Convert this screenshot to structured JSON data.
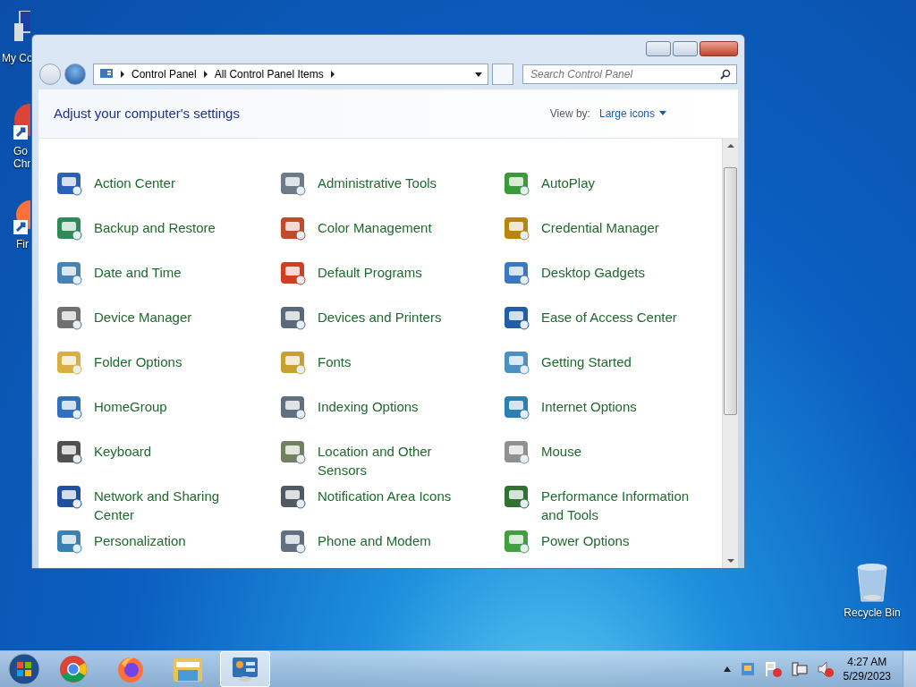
{
  "desktop_icons": [
    {
      "label": "My Co"
    },
    {
      "label": "Go Chr"
    },
    {
      "label": "Fir"
    },
    {
      "label": "Recycle Bin"
    }
  ],
  "window": {
    "breadcrumb": [
      "Control Panel",
      "All Control Panel Items"
    ],
    "search": {
      "placeholder": "Search Control Panel"
    },
    "heading": "Adjust your computer's settings",
    "view_by": {
      "label": "View by:",
      "value": "Large icons"
    },
    "items": [
      {
        "label": "Action Center"
      },
      {
        "label": "Administrative Tools"
      },
      {
        "label": "AutoPlay"
      },
      {
        "label": "Backup and Restore"
      },
      {
        "label": "Color Management"
      },
      {
        "label": "Credential Manager"
      },
      {
        "label": "Date and Time"
      },
      {
        "label": "Default Programs"
      },
      {
        "label": "Desktop Gadgets"
      },
      {
        "label": "Device Manager"
      },
      {
        "label": "Devices and Printers"
      },
      {
        "label": "Ease of Access Center"
      },
      {
        "label": "Folder Options"
      },
      {
        "label": "Fonts"
      },
      {
        "label": "Getting Started"
      },
      {
        "label": "HomeGroup"
      },
      {
        "label": "Indexing Options"
      },
      {
        "label": "Internet Options"
      },
      {
        "label": "Keyboard"
      },
      {
        "label": "Location and Other Sensors"
      },
      {
        "label": "Mouse"
      },
      {
        "label": "Network and Sharing Center"
      },
      {
        "label": "Notification Area Icons"
      },
      {
        "label": "Performance Information and Tools"
      },
      {
        "label": "Personalization"
      },
      {
        "label": "Phone and Modem"
      },
      {
        "label": "Power Options"
      }
    ]
  },
  "taskbar": {
    "apps": [
      {
        "kind": "chrome",
        "selected": false
      },
      {
        "kind": "firefox",
        "selected": false
      },
      {
        "kind": "folder",
        "selected": false
      },
      {
        "kind": "control-panel",
        "selected": true
      }
    ],
    "time": "4:27 AM",
    "date": "5/29/2023"
  }
}
